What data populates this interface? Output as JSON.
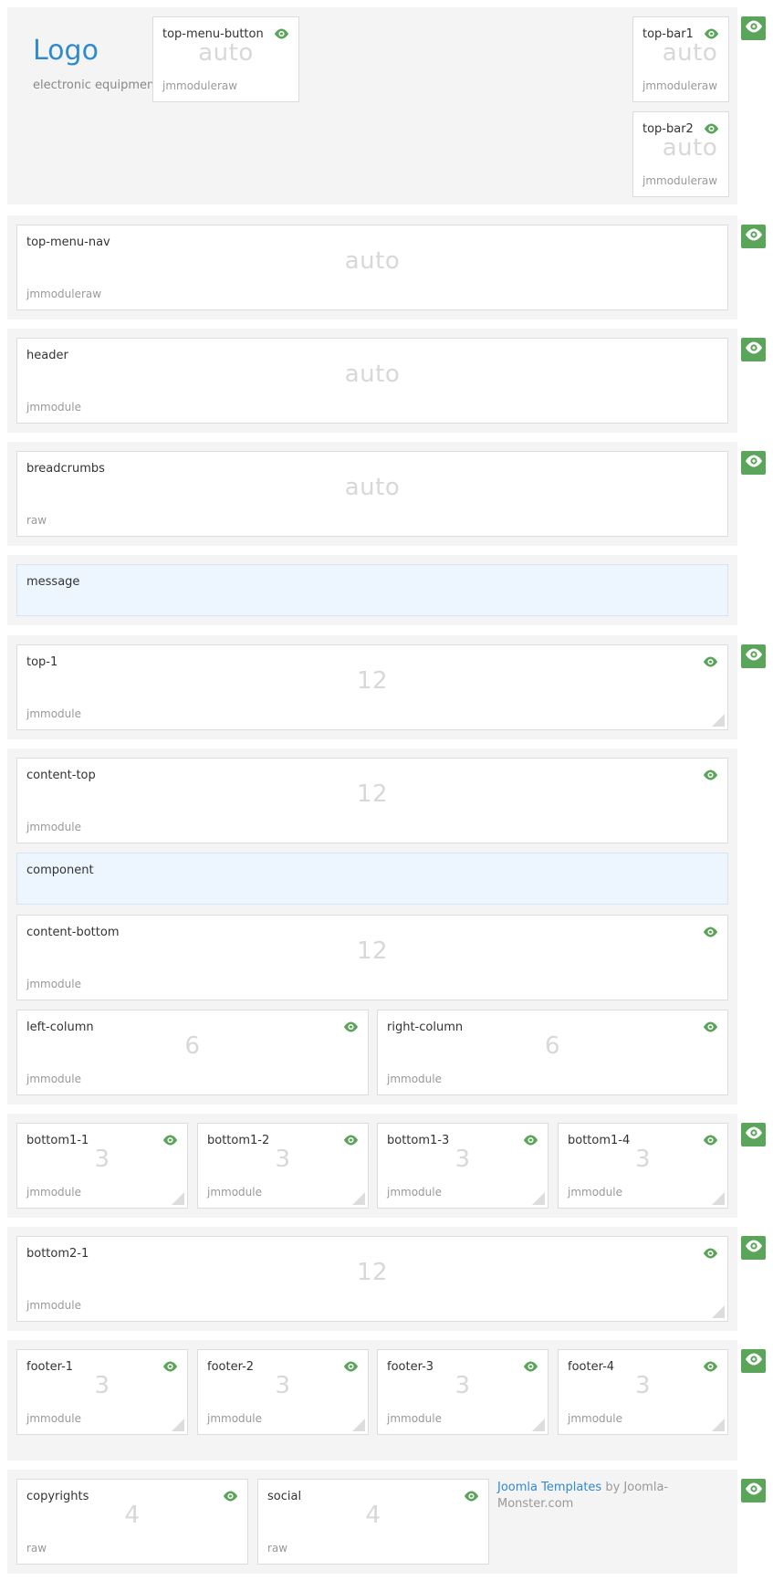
{
  "header": {
    "logo": "Logo",
    "tagline": "electronic equipment"
  },
  "size_auto": "auto",
  "modules": {
    "top_menu_button": {
      "name": "top-menu-button",
      "size": "auto",
      "style": "jmmoduleraw"
    },
    "top_bar1": {
      "name": "top-bar1",
      "size": "auto",
      "style": "jmmoduleraw"
    },
    "top_bar2": {
      "name": "top-bar2",
      "size": "auto",
      "style": "jmmoduleraw"
    },
    "top_menu_nav": {
      "name": "top-menu-nav",
      "size": "auto",
      "style": "jmmoduleraw"
    },
    "header": {
      "name": "header",
      "size": "auto",
      "style": "jmmodule"
    },
    "breadcrumbs": {
      "name": "breadcrumbs",
      "size": "auto",
      "style": "raw"
    },
    "message": {
      "name": "message"
    },
    "top_1": {
      "name": "top-1",
      "size": "12",
      "style": "jmmodule"
    },
    "content_top": {
      "name": "content-top",
      "size": "12",
      "style": "jmmodule"
    },
    "component": {
      "name": "component"
    },
    "content_bottom": {
      "name": "content-bottom",
      "size": "12",
      "style": "jmmodule"
    },
    "left_column": {
      "name": "left-column",
      "size": "6",
      "style": "jmmodule"
    },
    "right_column": {
      "name": "right-column",
      "size": "6",
      "style": "jmmodule"
    },
    "bottom1_1": {
      "name": "bottom1-1",
      "size": "3",
      "style": "jmmodule"
    },
    "bottom1_2": {
      "name": "bottom1-2",
      "size": "3",
      "style": "jmmodule"
    },
    "bottom1_3": {
      "name": "bottom1-3",
      "size": "3",
      "style": "jmmodule"
    },
    "bottom1_4": {
      "name": "bottom1-4",
      "size": "3",
      "style": "jmmodule"
    },
    "bottom2_1": {
      "name": "bottom2-1",
      "size": "12",
      "style": "jmmodule"
    },
    "footer_1": {
      "name": "footer-1",
      "size": "3",
      "style": "jmmodule"
    },
    "footer_2": {
      "name": "footer-2",
      "size": "3",
      "style": "jmmodule"
    },
    "footer_3": {
      "name": "footer-3",
      "size": "3",
      "style": "jmmodule"
    },
    "footer_4": {
      "name": "footer-4",
      "size": "3",
      "style": "jmmodule"
    },
    "copyrights": {
      "name": "copyrights",
      "size": "4",
      "style": "raw"
    },
    "social": {
      "name": "social",
      "size": "4",
      "style": "raw"
    }
  },
  "credit": {
    "link_text": "Joomla Templates",
    "rest_text": " by Joomla-Monster.com"
  },
  "icons": {
    "eye": "eye-icon",
    "resize": "resize-handle"
  },
  "colors": {
    "accent_green": "#5ba55b",
    "logo_blue": "#2f8acd",
    "row_bg": "#f4f4f4",
    "message_bg": "#edf5ff"
  }
}
